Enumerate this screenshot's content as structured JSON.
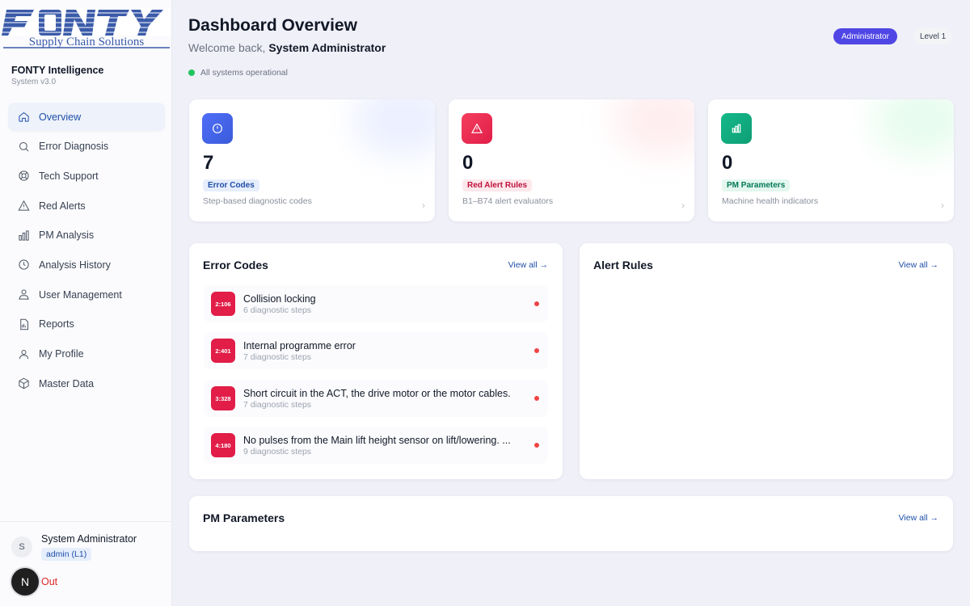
{
  "logo": {
    "top_text": "FONTY",
    "sub_text": "Supply Chain Solutions"
  },
  "brand": {
    "title": "FONTY Intelligence",
    "version": "System v3.0"
  },
  "nav": [
    {
      "label": "Overview",
      "icon": "home-icon"
    },
    {
      "label": "Error Diagnosis",
      "icon": "search-icon"
    },
    {
      "label": "Tech Support",
      "icon": "lifebuoy-icon"
    },
    {
      "label": "Red Alerts",
      "icon": "warning-icon"
    },
    {
      "label": "PM Analysis",
      "icon": "bar-chart-icon"
    },
    {
      "label": "Analysis History",
      "icon": "clock-icon"
    },
    {
      "label": "User Management",
      "icon": "users-icon"
    },
    {
      "label": "Reports",
      "icon": "document-icon"
    },
    {
      "label": "My Profile",
      "icon": "user-icon"
    },
    {
      "label": "Master Data",
      "icon": "cube-icon"
    }
  ],
  "user": {
    "initial": "S",
    "name": "System Administrator",
    "role": "admin (L1)",
    "signout_badge": "N",
    "signout_label": "Out"
  },
  "header": {
    "title": "Dashboard Overview",
    "welcome_prefix": "Welcome back, ",
    "welcome_name": "System Administrator",
    "status": "All systems operational",
    "role_badge": "Administrator",
    "level_badge": "Level 1"
  },
  "stats": [
    {
      "value": "7",
      "tag": "Error Codes",
      "desc": "Step-based diagnostic codes",
      "icon": "alert-circle-icon",
      "color": "#4f6ef7",
      "tag_bg": "#e6eefc",
      "tag_fg": "#1f4fa8"
    },
    {
      "value": "0",
      "tag": "Red Alert Rules",
      "desc": "B1–B74 alert evaluators",
      "icon": "warning-icon",
      "color": "#e11d48",
      "tag_bg": "#fde8ec",
      "tag_fg": "#be123c"
    },
    {
      "value": "0",
      "tag": "PM Parameters",
      "desc": "Machine health indicators",
      "icon": "bar-chart-icon",
      "color": "#10a37f",
      "tag_bg": "#e3f7ee",
      "tag_fg": "#047857"
    }
  ],
  "error_codes": {
    "title": "Error Codes",
    "view_all": "View all →",
    "items": [
      {
        "code": "2:106",
        "title": "Collision locking",
        "steps": "6 diagnostic steps"
      },
      {
        "code": "2:401",
        "title": "Internal programme error",
        "steps": "7 diagnostic steps"
      },
      {
        "code": "3:328",
        "title": "Short circuit in the ACT, the drive motor or the motor cables.",
        "steps": "7 diagnostic steps"
      },
      {
        "code": "4:180",
        "title": "No pulses from the Main lift height sensor on lift/lowering. ...",
        "steps": "9 diagnostic steps"
      }
    ]
  },
  "alert_rules": {
    "title": "Alert Rules",
    "view_all": "View all →"
  },
  "pm_parameters": {
    "title": "PM Parameters",
    "view_all": "View all →"
  }
}
